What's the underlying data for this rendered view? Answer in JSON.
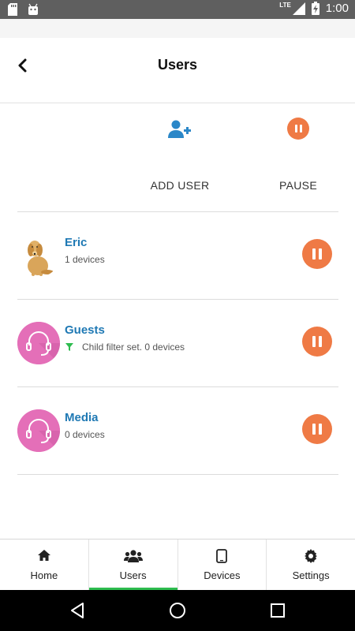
{
  "status_bar": {
    "network": "LTE",
    "time": "1:00",
    "icons": [
      "sd-card-icon",
      "android-icon",
      "signal-icon",
      "battery-charging-icon"
    ]
  },
  "header": {
    "title": "Users",
    "back_icon": "back-arrow-icon"
  },
  "actions": [
    {
      "label": "ADD USER",
      "icon": "add-user-icon",
      "color": "#2b87c8"
    },
    {
      "label": "PAUSE",
      "icon": "pause-icon",
      "color": "#ef7a45"
    }
  ],
  "users": [
    {
      "name": "Eric",
      "subtitle": "1 devices",
      "avatar": "dog-photo",
      "filter": ""
    },
    {
      "name": "Guests",
      "subtitle": "Child filter set. 0 devices",
      "avatar": "headset-avatar-icon",
      "filter": "filter-icon"
    },
    {
      "name": "Media",
      "subtitle": "0 devices",
      "avatar": "headset-avatar-icon",
      "filter": ""
    }
  ],
  "bottom_nav": {
    "active": "Users",
    "items": [
      {
        "label": "Home",
        "icon": "home-icon"
      },
      {
        "label": "Users",
        "icon": "users-icon"
      },
      {
        "label": "Devices",
        "icon": "tablet-icon"
      },
      {
        "label": "Settings",
        "icon": "gear-icon"
      }
    ]
  },
  "colors": {
    "accent_blue": "#1f79b4",
    "pause_orange": "#ef7a45",
    "avatar_pink": "#e46fb8",
    "active_tab": "#2ebc4f",
    "filter_green": "#2ebc4f"
  }
}
